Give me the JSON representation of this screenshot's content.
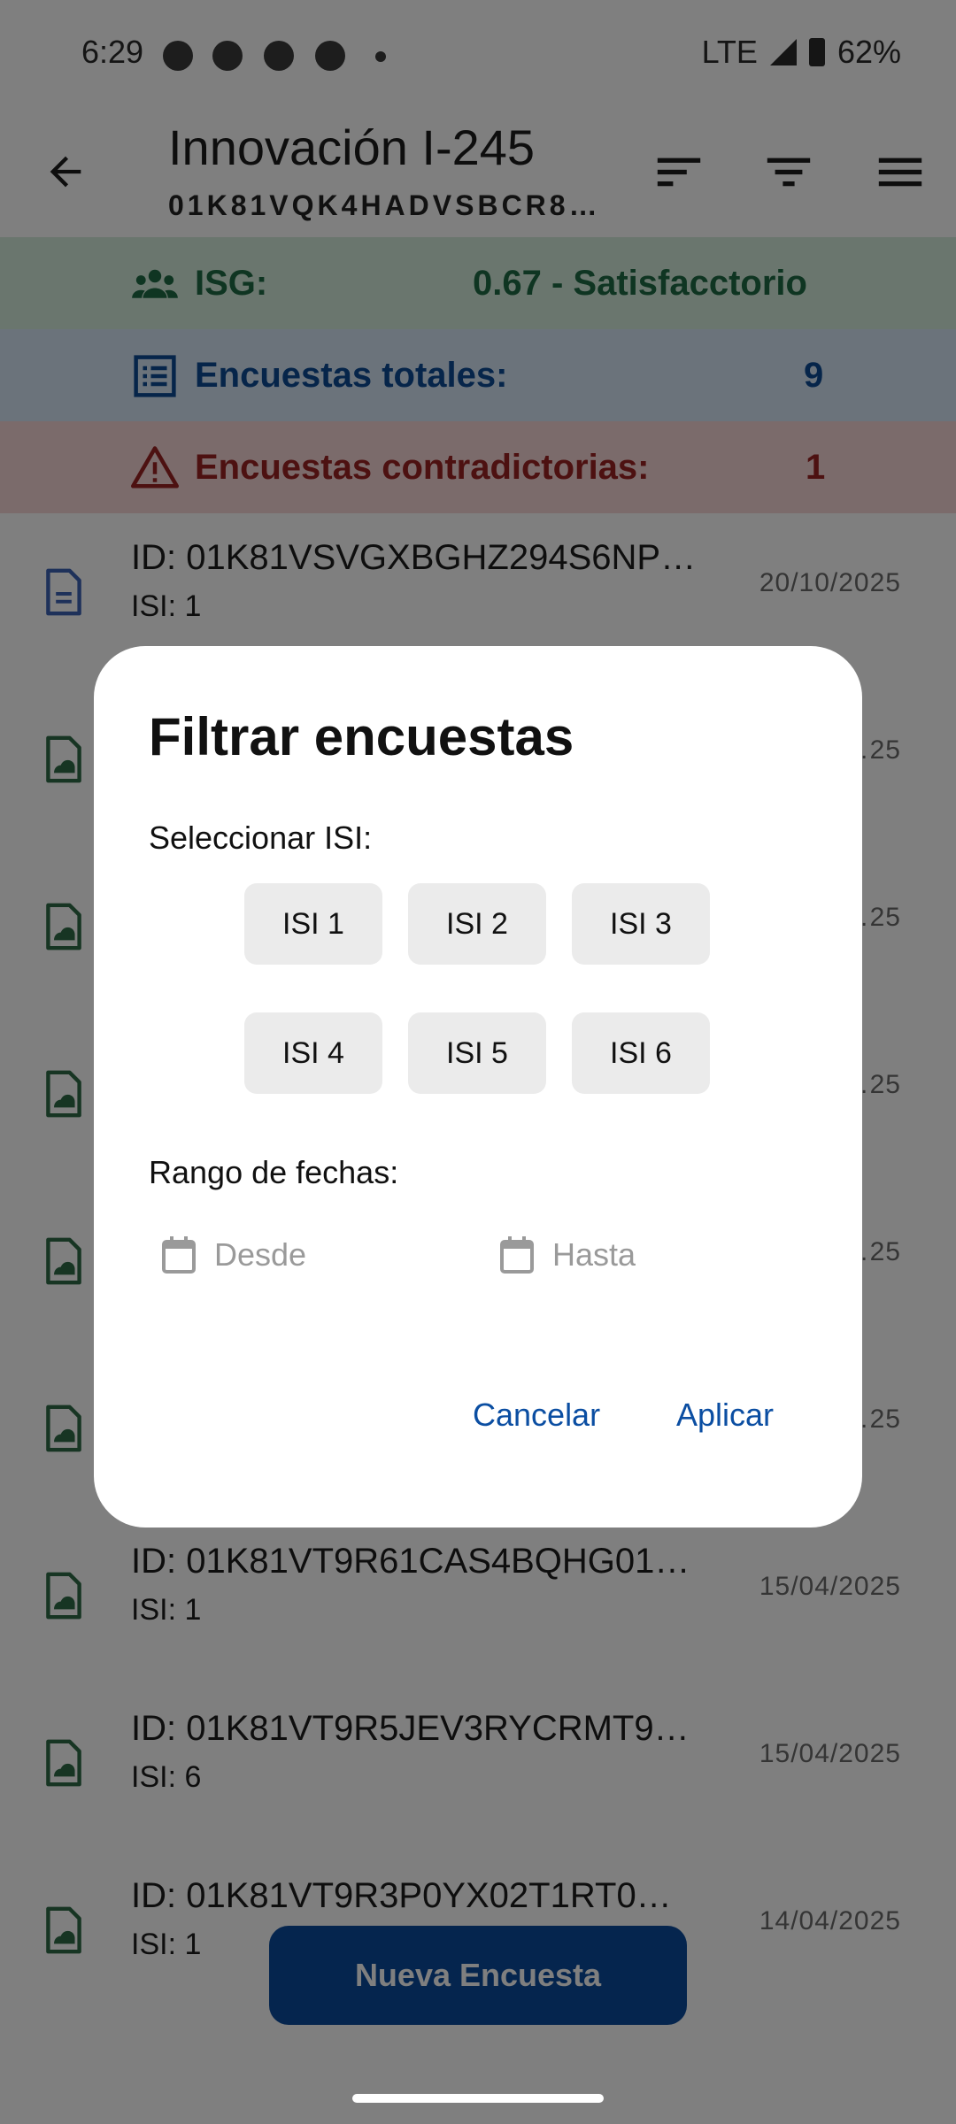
{
  "status_bar": {
    "time": "6:29",
    "network": "LTE",
    "battery": "62%"
  },
  "app_bar": {
    "title": "Innovación I-245",
    "subtitle": "01K81VQK4HADVSBCR8…"
  },
  "summary": {
    "isg": {
      "label": "ISG:",
      "value": "0.67 - Satisfacctorio",
      "color": "#1e6b44"
    },
    "totales": {
      "label": "Encuestas totales:",
      "value": "9",
      "color": "#0c4a94"
    },
    "contradictorias": {
      "label": "Encuestas contradictorias:",
      "value": "1",
      "color": "#9b2222"
    }
  },
  "list": [
    {
      "id": "ID: 01K81VSVGXBGHZ294S6NP…",
      "isi": "ISI: 1",
      "date": "20/10/2025",
      "icon": "document-icon"
    },
    {
      "id": "",
      "isi": "",
      "date": "…25",
      "icon": "image-document-icon"
    },
    {
      "id": "",
      "isi": "",
      "date": "…25",
      "icon": "image-document-icon"
    },
    {
      "id": "",
      "isi": "",
      "date": "…25",
      "icon": "image-document-icon"
    },
    {
      "id": "",
      "isi": "",
      "date": "…25",
      "icon": "image-document-icon"
    },
    {
      "id": "",
      "isi": "",
      "date": "…25",
      "icon": "image-document-icon"
    },
    {
      "id": "ID: 01K81VT9R61CAS4BQHG01…",
      "isi": "ISI: 1",
      "date": "15/04/2025",
      "icon": "image-document-icon"
    },
    {
      "id": "ID: 01K81VT9R5JEV3RYCRMT9…",
      "isi": "ISI: 6",
      "date": "15/04/2025",
      "icon": "image-document-icon"
    },
    {
      "id": "ID: 01K81VT9R3P0YX02T1RT0…",
      "isi": "ISI: 1",
      "date": "14/04/2025",
      "icon": "image-document-icon"
    }
  ],
  "fab": {
    "label": "Nueva Encuesta"
  },
  "dialog": {
    "title": "Filtrar encuestas",
    "isi_label": "Seleccionar ISI:",
    "chips": [
      "ISI 1",
      "ISI 2",
      "ISI 3",
      "ISI 4",
      "ISI 5",
      "ISI 6"
    ],
    "date_label": "Rango de fechas:",
    "from_placeholder": "Desde",
    "to_placeholder": "Hasta",
    "cancel": "Cancelar",
    "apply": "Aplicar"
  }
}
